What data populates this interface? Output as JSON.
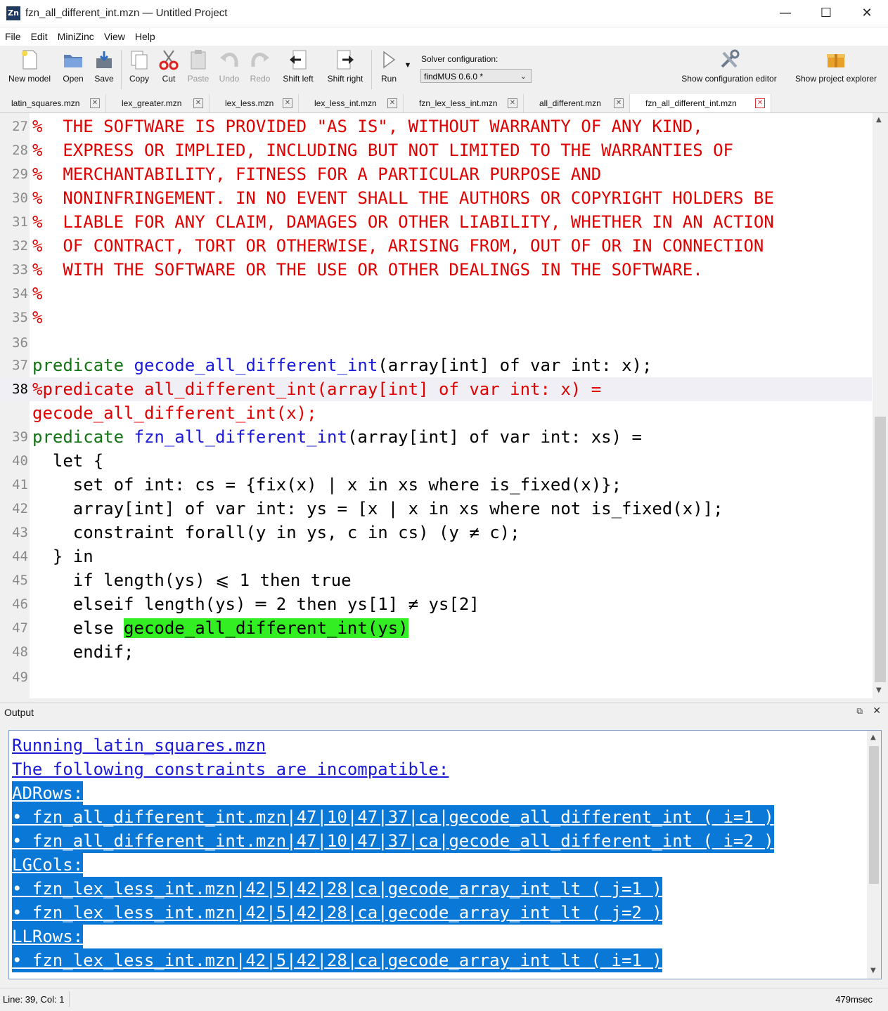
{
  "window": {
    "title": "fzn_all_different_int.mzn — Untitled Project",
    "app_icon": "Zn",
    "controls": [
      "—",
      "☐",
      "✕"
    ]
  },
  "menu": [
    "File",
    "Edit",
    "MiniZinc",
    "View",
    "Help"
  ],
  "toolbar": {
    "new_model": "New model",
    "open": "Open",
    "save": "Save",
    "copy": "Copy",
    "cut": "Cut",
    "paste": "Paste",
    "undo": "Undo",
    "redo": "Redo",
    "shift_left": "Shift left",
    "shift_right": "Shift right",
    "run": "Run",
    "solver_label": "Solver configuration:",
    "solver_value": "findMUS 0.6.0 *",
    "config_editor": "Show configuration editor",
    "project_explorer": "Show project explorer"
  },
  "tabs": [
    {
      "label": "latin_squares.mzn",
      "active": false
    },
    {
      "label": "lex_greater.mzn",
      "active": false
    },
    {
      "label": "lex_less.mzn",
      "active": false
    },
    {
      "label": "lex_less_int.mzn",
      "active": false
    },
    {
      "label": "fzn_lex_less_int.mzn",
      "active": false
    },
    {
      "label": "all_different.mzn",
      "active": false
    },
    {
      "label": "fzn_all_different_int.mzn",
      "active": true
    }
  ],
  "editor": {
    "line_numbers": [
      "27",
      "28",
      "29",
      "30",
      "31",
      "32",
      "33",
      "34",
      "35",
      "36",
      "37",
      "38",
      "39",
      "40",
      "41",
      "42",
      "43",
      "44",
      "45",
      "46",
      "47",
      "48",
      "49"
    ],
    "comment_lines": [
      "%  THE SOFTWARE IS PROVIDED \"AS IS\", WITHOUT WARRANTY OF ANY KIND,",
      "%  EXPRESS OR IMPLIED, INCLUDING BUT NOT LIMITED TO THE WARRANTIES OF",
      "%  MERCHANTABILITY, FITNESS FOR A PARTICULAR PURPOSE AND",
      "%  NONINFRINGEMENT. IN NO EVENT SHALL THE AUTHORS OR COPYRIGHT HOLDERS BE",
      "%  LIABLE FOR ANY CLAIM, DAMAGES OR OTHER LIABILITY, WHETHER IN AN ACTION",
      "%  OF CONTRACT, TORT OR OTHERWISE, ARISING FROM, OUT OF OR IN CONNECTION",
      "%  WITH THE SOFTWARE OR THE USE OR OTHER DEALINGS IN THE SOFTWARE.",
      "%",
      "%"
    ],
    "line37": {
      "kw": "predicate",
      "fn": "gecode_all_different_int",
      "rest": "(array[int] of var int: x);"
    },
    "line38a": "%predicate all_different_int(array[int] of var int: x) =",
    "line38b": "gecode_all_different_int(x);",
    "line39": {
      "kw": "predicate",
      "fn": "fzn_all_different_int",
      "rest": "(array[int] of var int: xs) ="
    },
    "line40": "  let {",
    "line41": "    set of int: cs = {fix(x) | x in xs where is_fixed(x)};",
    "line42": "    array[int] of var int: ys = [x | x in xs where not is_fixed(x)];",
    "line43": "    constraint forall(y in ys, c in cs) (y ≠ c);",
    "line44": "  } in",
    "line45": "    if length(ys) ⩽ 1 then true",
    "line46": "    elseif length(ys) ═ 2 then ys[1] ≠ ys[2]",
    "line47_pre": "    else ",
    "line47_hl": "gecode_all_different_int(ys)",
    "line48": "    endif;"
  },
  "output": {
    "title": "Output",
    "lines": [
      {
        "text": "Running latin_squares.mzn",
        "selected": false
      },
      {
        "text": "The following constraints are incompatible:",
        "selected": false
      },
      {
        "text": "ADRows:",
        "selected": true
      },
      {
        "text": "• fzn_all_different_int.mzn|47|10|47|37|ca|gecode_all_different_int ( i=1 )",
        "selected": true
      },
      {
        "text": "• fzn_all_different_int.mzn|47|10|47|37|ca|gecode_all_different_int ( i=2 )",
        "selected": true
      },
      {
        "text": "LGCols:",
        "selected": true
      },
      {
        "text": "• fzn_lex_less_int.mzn|42|5|42|28|ca|gecode_array_int_lt ( j=1 )",
        "selected": true
      },
      {
        "text": "• fzn_lex_less_int.mzn|42|5|42|28|ca|gecode_array_int_lt ( j=2 )",
        "selected": true
      },
      {
        "text": "LLRows:",
        "selected": true
      },
      {
        "text": "• fzn_lex_less_int.mzn|42|5|42|28|ca|gecode_array_int_lt ( i=1 )",
        "selected": true
      }
    ]
  },
  "status": {
    "position": "Line: 39, Col: 1",
    "time": "479msec"
  },
  "colors": {
    "comment": "#e00000",
    "keyword": "#137413",
    "function": "#1a1ad8",
    "highlight": "#33ee22",
    "selection": "#0a78d7"
  }
}
